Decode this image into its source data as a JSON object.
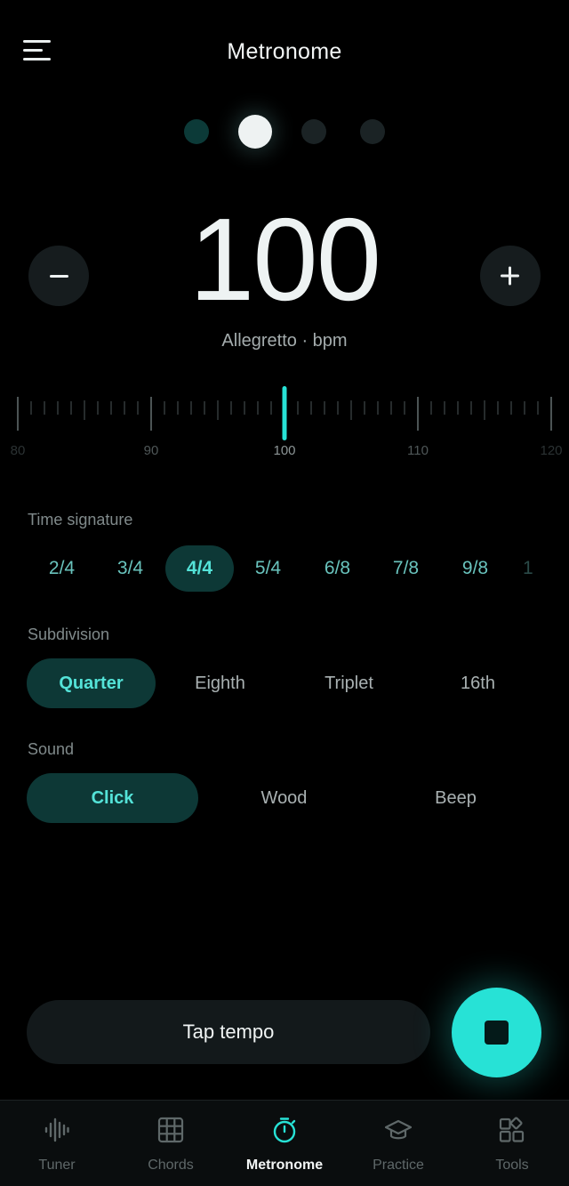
{
  "header": {
    "title": "Metronome",
    "menu_icon": "hamburger-menu-icon"
  },
  "beats": {
    "count": 4,
    "current": 2
  },
  "tempo": {
    "bpm": "100",
    "marking": "Allegretto · bpm",
    "decrease_icon": "minus-icon",
    "increase_icon": "plus-icon"
  },
  "ruler": {
    "labels": [
      "80",
      "90",
      "100",
      "110",
      "120"
    ],
    "min": 80,
    "max": 120,
    "value": 100
  },
  "time_signature": {
    "label": "Time signature",
    "options": [
      "2/4",
      "3/4",
      "4/4",
      "5/4",
      "6/8",
      "7/8",
      "9/8",
      "1"
    ],
    "selected": "4/4"
  },
  "subdivision": {
    "label": "Subdivision",
    "options": [
      "Quarter",
      "Eighth",
      "Triplet",
      "16th"
    ],
    "selected": "Quarter"
  },
  "sound": {
    "label": "Sound",
    "options": [
      "Click",
      "Wood",
      "Beep"
    ],
    "selected": "Click"
  },
  "actions": {
    "tap_tempo": "Tap tempo",
    "stop_icon": "stop-icon"
  },
  "nav": {
    "items": [
      {
        "label": "Tuner",
        "icon": "waveform-icon"
      },
      {
        "label": "Chords",
        "icon": "grid-icon"
      },
      {
        "label": "Metronome",
        "icon": "stopwatch-icon"
      },
      {
        "label": "Practice",
        "icon": "graduation-cap-icon"
      },
      {
        "label": "Tools",
        "icon": "apps-icon"
      }
    ],
    "active": "Metronome"
  },
  "colors": {
    "accent": "#27e2d6",
    "accent_text": "#54e3d8",
    "selected_bg": "#0d3836",
    "background": "#000000"
  }
}
